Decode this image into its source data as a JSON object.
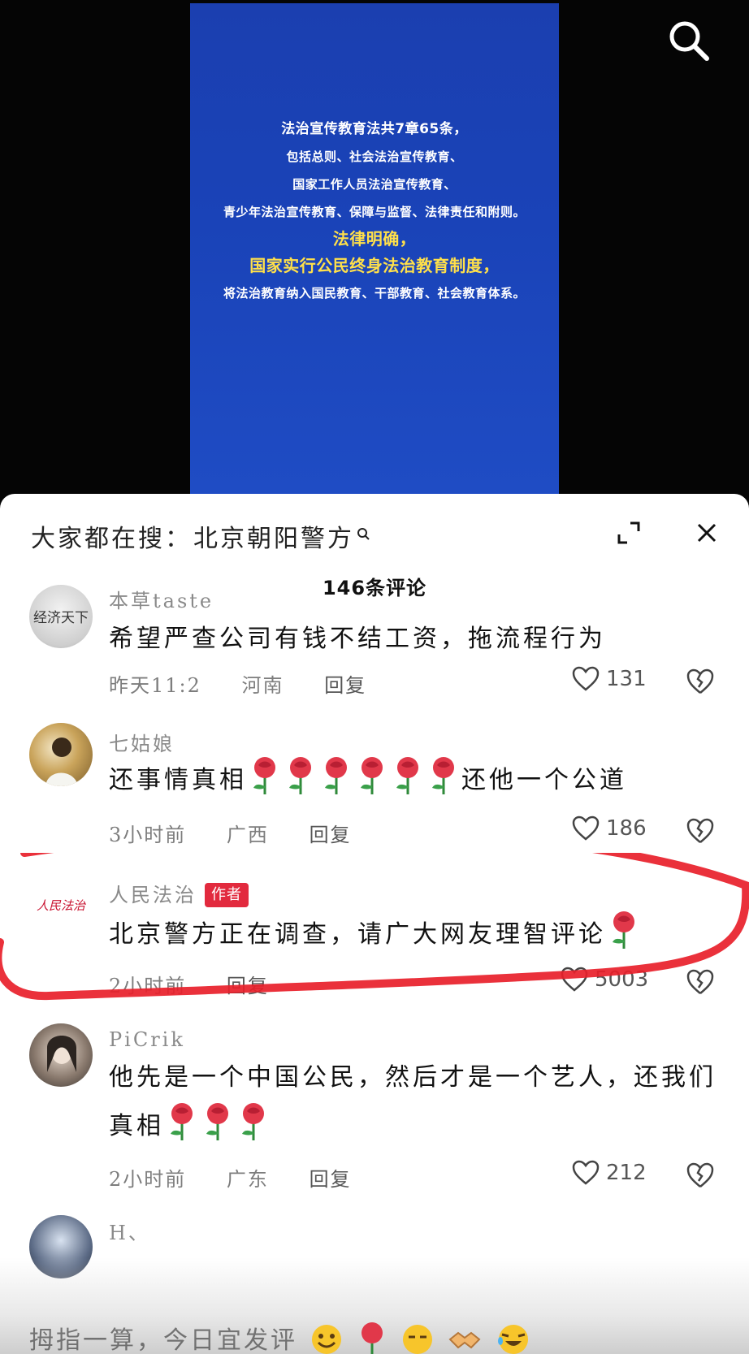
{
  "video": {
    "lines": [
      "法治宣传教育法共7章65条，",
      "包括总则、社会法治宣传教育、",
      "国家工作人员法治宣传教育、",
      "青少年法治宣传教育、保障与监督、法律责任和附则。",
      "法律明确，",
      "国家实行公民终身法治教育制度，",
      "将法治教育纳入国民教育、干部教育、社会教育体系。"
    ],
    "highlight_color": "#ffe04a",
    "background_color": "#1a43b8"
  },
  "comment_panel": {
    "hot_search_prefix": "大家都在搜：",
    "hot_search_term": "北京朝阳警方",
    "comment_count_label": "146条评论"
  },
  "comments": [
    {
      "username": "本草taste",
      "avatar_label": "经济天下",
      "text": "希望严查公司有钱不结工资，拖流程行为",
      "time": "昨天11:2",
      "location": "河南",
      "reply_label": "回复",
      "likes": "131"
    },
    {
      "username": "七姑娘",
      "text": "还事情真相",
      "text_after": "还他一个公道",
      "rose_count": 6,
      "time": "3小时前",
      "location": "广西",
      "reply_label": "回复",
      "likes": "186"
    },
    {
      "username": "人民法治",
      "badge": "作者",
      "avatar_label": "人民法治",
      "text": "北京警方正在调查，请广大网友理智评论",
      "rose_count": 1,
      "time": "2小时前",
      "reply_label": "回复",
      "likes": "5003"
    },
    {
      "username": "PiCrik",
      "text": "他先是一个中国公民，然后才是一个艺人，还我们真相",
      "rose_count": 3,
      "time": "2小时前",
      "location": "广东",
      "reply_label": "回复",
      "likes": "212"
    },
    {
      "username": "H、"
    }
  ],
  "bottom_bar": {
    "prompt_text": "拇指一算，今日宜发评"
  },
  "colors": {
    "badge": "#e22a3e",
    "annotation_stroke": "#e8202a"
  }
}
